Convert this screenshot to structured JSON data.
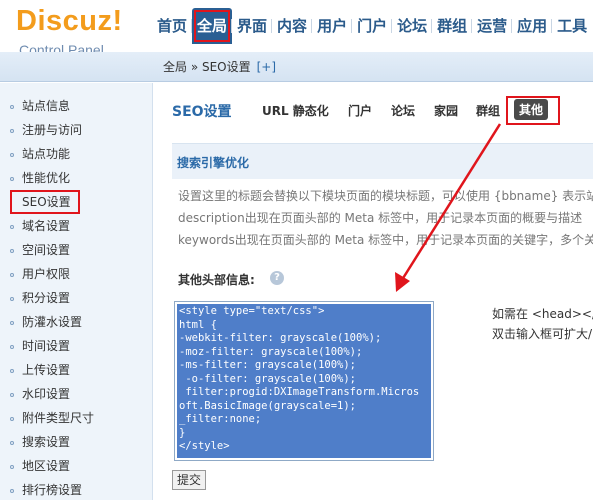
{
  "logo": {
    "name": "Discuz!",
    "sub": "Control Panel"
  },
  "topnav": [
    "首页",
    "全局",
    "界面",
    "内容",
    "用户",
    "门户",
    "论坛",
    "群组",
    "运营",
    "应用",
    "工具"
  ],
  "topnav_active": "全局",
  "breadcrumb": {
    "text": "全局 » SEO设置",
    "add": "[+]"
  },
  "sidebar": {
    "items": [
      "站点信息",
      "注册与访问",
      "站点功能",
      "性能优化",
      "SEO设置",
      "域名设置",
      "空间设置",
      "用户权限",
      "积分设置",
      "防灌水设置",
      "时间设置",
      "上传设置",
      "水印设置",
      "附件类型尺寸",
      "搜索设置",
      "地区设置",
      "排行榜设置"
    ],
    "active": "SEO设置"
  },
  "tabs": {
    "title": "SEO设置",
    "items": [
      "URL 静态化",
      "门户",
      "论坛",
      "家园",
      "群组",
      "其他"
    ],
    "active": "其他"
  },
  "section": {
    "title": "搜索引擎优化"
  },
  "descriptions": [
    "设置这里的标题会替换以下模块页面的模块标题，可以使用 {bbname} 表示站",
    "description出现在页面头部的 Meta 标签中，用于记录本页面的概要与描述",
    "keywords出现在页面头部的 Meta 标签中，用于记录本页面的关键字，多个关"
  ],
  "field": {
    "label": "其他头部信息:",
    "value": "<style type=\"text/css\">\nhtml {\n-webkit-filter: grayscale(100%);\n-moz-filter: grayscale(100%);\n-ms-filter: grayscale(100%);\n -o-filter: grayscale(100%);\n filter:progid:DXImageTransform.Micros\noft.BasicImage(grayscale=1);\n_filter:none;\n}\n</style>",
    "hints": [
      "如需在 <head></",
      "双击输入框可扩大/"
    ]
  },
  "submit_label": "提交",
  "colors": {
    "brand": "#f39c1c",
    "nav": "#2b5b8b",
    "highlight": "#e0151c",
    "selection": "#4f7ec9"
  }
}
